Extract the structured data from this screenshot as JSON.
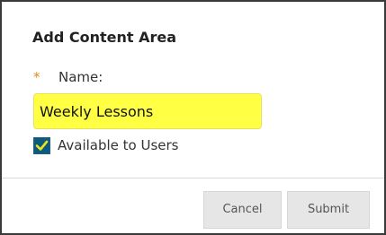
{
  "dialog": {
    "title": "Add Content Area",
    "name_field": {
      "required_mark": "*",
      "label": "Name:",
      "value": "Weekly Lessons"
    },
    "availability": {
      "label": "Available to Users",
      "checked": true
    },
    "buttons": {
      "cancel_label": "Cancel",
      "submit_label": "Submit"
    }
  },
  "colors": {
    "required_star": "#e08a1e",
    "input_highlight": "#ffff44",
    "checkbox_fill": "#0e5a7f",
    "checkmark": "#f0e31c",
    "button_bg": "#e6e6e6"
  },
  "icons": {
    "checkbox": "checkmark-icon"
  }
}
